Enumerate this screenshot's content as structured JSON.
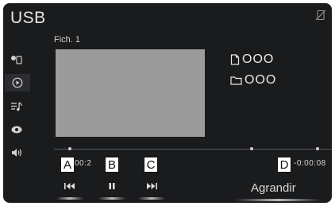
{
  "header": {
    "title": "USB"
  },
  "track": {
    "filename": "Fich. 1",
    "file_label": "OOO",
    "folder_label": "OOO"
  },
  "playback": {
    "elapsed": "00:2",
    "remaining": "-0:00:08"
  },
  "controls": {
    "enlarge_label": "Agrandir"
  },
  "callouts": {
    "a": "A",
    "b": "B",
    "c": "C",
    "d": "D"
  },
  "colors": {
    "screen_bg": "#1a1b1d",
    "artwork": "#9b9b9b",
    "text": "#e6e6e6"
  }
}
